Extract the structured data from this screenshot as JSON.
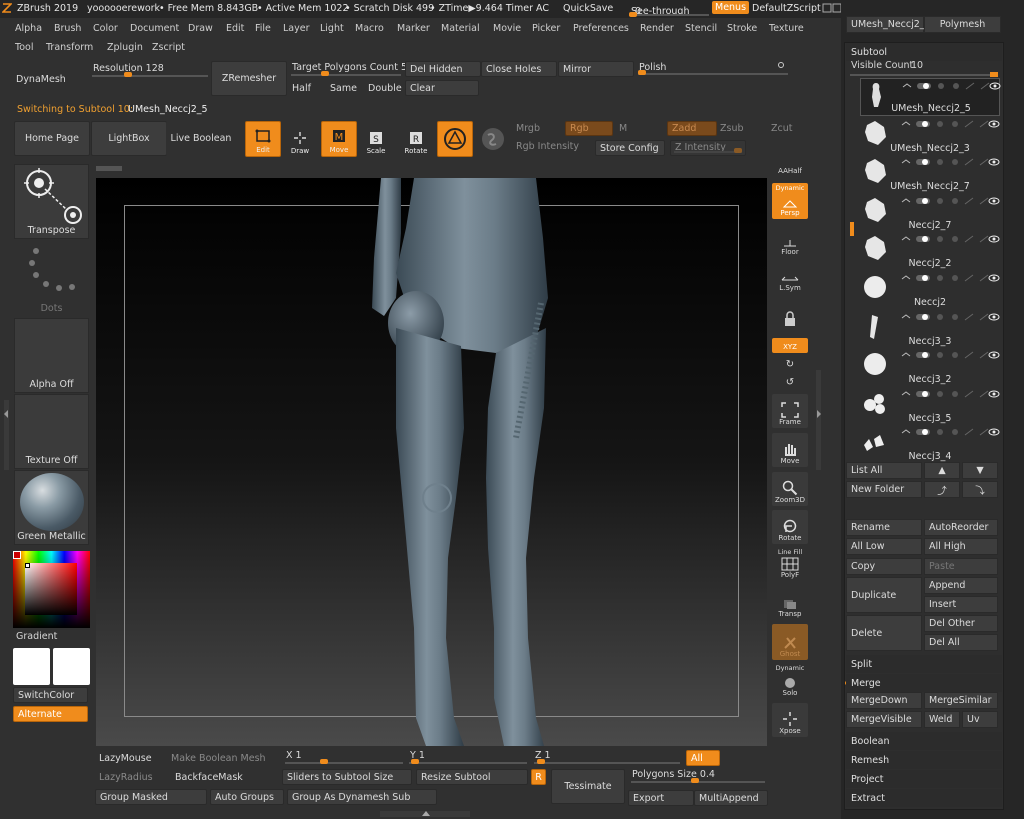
{
  "titlebar": {
    "app": "ZBrush 2019",
    "doc": "yoooooerework",
    "free_mem": "• Free Mem 8.843GB",
    "active_mem": "• Active Mem 1022",
    "scratch": "• Scratch Disk 499",
    "ztime": "• ZTime▶9.464 Timer",
    "ac": "AC",
    "quicksave": "QuickSave",
    "seethrough": "See-through",
    "seethrough_val": "0",
    "menus": "Menus",
    "defaultzscript": "DefaultZScript"
  },
  "menus_row1": [
    "Alpha",
    "Brush",
    "Color",
    "Document",
    "Draw",
    "Edit",
    "File",
    "Layer",
    "Light",
    "Macro",
    "Marker",
    "Material",
    "Movie",
    "Picker",
    "Preferences",
    "Render",
    "Stencil",
    "Stroke",
    "Texture"
  ],
  "menus_row2": [
    "Tool",
    "Transform",
    "Zplugin",
    "Zscript"
  ],
  "dynamesh": {
    "dynamesh": "DynaMesh",
    "resolution_label": "Resolution",
    "resolution_val": "128",
    "resolution_frac": 0.28,
    "zremesher": "ZRemesher",
    "target_poly_label": "Target Polygons Count",
    "target_poly_val": "5",
    "target_poly_frac": 0.27,
    "del_hidden": "Del Hidden",
    "close_holes": "Close Holes",
    "mirror": "Mirror",
    "polish": "Polish",
    "half": "Half",
    "same": "Same",
    "double": "Double",
    "clear": "Clear"
  },
  "switching": {
    "label": "Switching to Subtool 10:",
    "name": "UMesh_Neccj2_5"
  },
  "toolbar": {
    "home_page": "Home Page",
    "lightbox": "LightBox",
    "live_boolean": "Live Boolean",
    "edit": "Edit",
    "draw": "Draw",
    "move": "Move",
    "scale": "Scale",
    "rotate": "Rotate",
    "mrgb": "Mrgb",
    "rgb": "Rgb",
    "m": "M",
    "zadd": "Zadd",
    "zsub": "Zsub",
    "zcut": "Zcut",
    "rgb_intensity": "Rgb Intensity",
    "store_config": "Store Config",
    "z_intensity": "Z Intensity"
  },
  "left_tiles": {
    "transpose": "Transpose",
    "dots": "Dots",
    "alpha_off": "Alpha Off",
    "texture_off": "Texture Off",
    "material": "Green Metallic",
    "gradient": "Gradient",
    "switchcolor": "SwitchColor",
    "alternate": "Alternate"
  },
  "right_shelf": {
    "aahalf": "AAHalf",
    "dynamic": "Dynamic",
    "persp": "Persp",
    "floor": "Floor",
    "lsym": "L.Sym",
    "xyz": "XYZ",
    "frame": "Frame",
    "move": "Move",
    "zoom3d": "Zoom3D",
    "rotate": "Rotate",
    "line_fill": "Line Fill",
    "polyf": "PolyF",
    "transp": "Transp",
    "ghost": "Ghost",
    "dynamic2": "Dynamic",
    "solo": "Solo",
    "xpose": "Xpose"
  },
  "bottom": {
    "lazymouse": "LazyMouse",
    "make_boolean": "Make Boolean Mesh",
    "x_label": "X",
    "x_val": "1",
    "y_label": "Y",
    "y_val": "1",
    "z_label": "Z",
    "z_val": "1",
    "all": "All",
    "lazyradius": "LazyRadius",
    "backfacemask": "BackfaceMask",
    "sliders_to_subtool": "Sliders to Subtool Size",
    "resize_subtool": "Resize Subtool",
    "r": "R",
    "tessimate": "Tessimate",
    "polygons_size_label": "Polygons Size",
    "polygons_size_val": "0.4",
    "group_masked": "Group Masked",
    "auto_groups": "Auto Groups",
    "group_as_dynamesh": "Group As Dynamesh Sub",
    "export": "Export",
    "multiappend": "MultiAppend"
  },
  "right_panel": {
    "top_tool": "UMesh_Neccj2_5",
    "polymesh": "Polymesh",
    "subtool": "Subtool",
    "visible_count_label": "Visible Count",
    "visible_count_val": "10",
    "items": [
      {
        "name": "UMesh_Neccj2_5",
        "thumb": "figure"
      },
      {
        "name": "UMesh_Neccj2_3",
        "thumb": "rock"
      },
      {
        "name": "UMesh_Neccj2_7",
        "thumb": "rock"
      },
      {
        "name": "Neccj2_7",
        "thumb": "rock"
      },
      {
        "name": "Neccj2_2",
        "thumb": "rock"
      },
      {
        "name": "Neccj2",
        "thumb": "sphere"
      },
      {
        "name": "Neccj3_3",
        "thumb": "stick"
      },
      {
        "name": "Neccj3_2",
        "thumb": "sphere"
      },
      {
        "name": "Neccj3_5",
        "thumb": "lumps"
      },
      {
        "name": "Neccj3_4",
        "thumb": "pieces"
      }
    ],
    "list_all": "List All",
    "new_folder": "New Folder",
    "rename": "Rename",
    "autoreorder": "AutoReorder",
    "all_low": "All Low",
    "all_high": "All High",
    "copy": "Copy",
    "paste": "Paste",
    "duplicate": "Duplicate",
    "append": "Append",
    "insert": "Insert",
    "delete": "Delete",
    "del_other": "Del Other",
    "del_all": "Del All",
    "split": "Split",
    "merge": "Merge",
    "mergedown": "MergeDown",
    "mergesimilar": "MergeSimilar",
    "mergevisible": "MergeVisible",
    "weld": "Weld",
    "uv": "Uv",
    "boolean": "Boolean",
    "remesh": "Remesh",
    "project": "Project",
    "extract": "Extract"
  },
  "colors": {
    "accent": "#f08c1c",
    "panel": "#303030",
    "button": "#3d3d3d"
  }
}
